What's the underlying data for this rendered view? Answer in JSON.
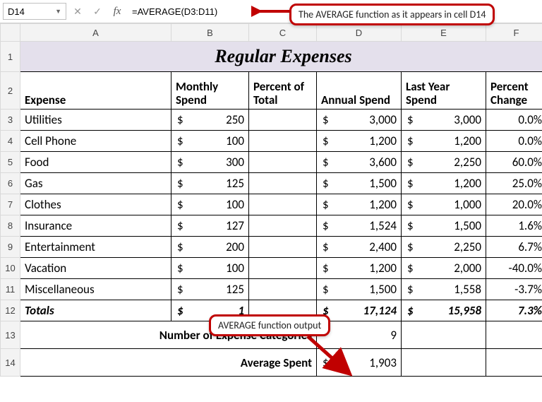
{
  "formula_bar": {
    "cell_ref": "D14",
    "cancel": "✕",
    "confirm": "✓",
    "fx": "fx",
    "formula": "=AVERAGE(D3:D11)"
  },
  "callouts": {
    "top": "The AVERAGE function as it appears in cell D14",
    "mid": "AVERAGE function output"
  },
  "col_headers": [
    "A",
    "B",
    "C",
    "D",
    "E",
    "F"
  ],
  "row_headers": [
    "1",
    "2",
    "3",
    "4",
    "5",
    "6",
    "7",
    "8",
    "9",
    "10",
    "11",
    "12",
    "13",
    "14"
  ],
  "title": "Regular Expenses",
  "headers": {
    "expense": "Expense",
    "monthly": "Monthly Spend",
    "pct_total": "Percent of Total",
    "annual": "Annual Spend",
    "last_year": "Last Year Spend",
    "pct_change": "Percent Change"
  },
  "rows": [
    {
      "expense": "Utilities",
      "monthly": "250",
      "annual": "3,000",
      "last_year": "3,000",
      "pct_change": "0.0%"
    },
    {
      "expense": "Cell Phone",
      "monthly": "100",
      "annual": "1,200",
      "last_year": "1,200",
      "pct_change": "0.0%"
    },
    {
      "expense": "Food",
      "monthly": "300",
      "annual": "3,600",
      "last_year": "2,250",
      "pct_change": "60.0%"
    },
    {
      "expense": "Gas",
      "monthly": "125",
      "annual": "1,500",
      "last_year": "1,200",
      "pct_change": "25.0%"
    },
    {
      "expense": "Clothes",
      "monthly": "100",
      "annual": "1,200",
      "last_year": "1,000",
      "pct_change": "20.0%"
    },
    {
      "expense": "Insurance",
      "monthly": "127",
      "annual": "1,524",
      "last_year": "1,500",
      "pct_change": "1.6%"
    },
    {
      "expense": "Entertainment",
      "monthly": "200",
      "annual": "2,400",
      "last_year": "2,250",
      "pct_change": "6.7%"
    },
    {
      "expense": "Vacation",
      "monthly": "100",
      "annual": "1,200",
      "last_year": "2,000",
      "pct_change": "-40.0%"
    },
    {
      "expense": "Miscellaneous",
      "monthly": "125",
      "annual": "1,500",
      "last_year": "1,558",
      "pct_change": "-3.7%"
    }
  ],
  "totals": {
    "label": "Totals",
    "monthly": "1",
    "annual": "17,124",
    "last_year": "15,958",
    "pct_change": "7.3%"
  },
  "row13": {
    "label": "Number of Expense Categories",
    "value": "9"
  },
  "row14": {
    "label": "Average Spent",
    "value": "1,903"
  },
  "dollar": "$",
  "chart_data": {
    "type": "table",
    "title": "Regular Expenses",
    "columns": [
      "Expense",
      "Monthly Spend",
      "Percent of Total",
      "Annual Spend",
      "Last Year Spend",
      "Percent Change"
    ],
    "rows": [
      [
        "Utilities",
        250,
        null,
        3000,
        3000,
        0.0
      ],
      [
        "Cell Phone",
        100,
        null,
        1200,
        1200,
        0.0
      ],
      [
        "Food",
        300,
        null,
        3600,
        2250,
        60.0
      ],
      [
        "Gas",
        125,
        null,
        1500,
        1200,
        25.0
      ],
      [
        "Clothes",
        100,
        null,
        1200,
        1000,
        20.0
      ],
      [
        "Insurance",
        127,
        null,
        1524,
        1500,
        1.6
      ],
      [
        "Entertainment",
        200,
        null,
        2400,
        2250,
        6.7
      ],
      [
        "Vacation",
        100,
        null,
        1200,
        2000,
        -40.0
      ],
      [
        "Miscellaneous",
        125,
        null,
        1500,
        1558,
        -3.7
      ]
    ],
    "totals": {
      "Annual Spend": 17124,
      "Last Year Spend": 15958,
      "Percent Change": 7.3
    },
    "count": 9,
    "average_annual_spend": 1903
  }
}
